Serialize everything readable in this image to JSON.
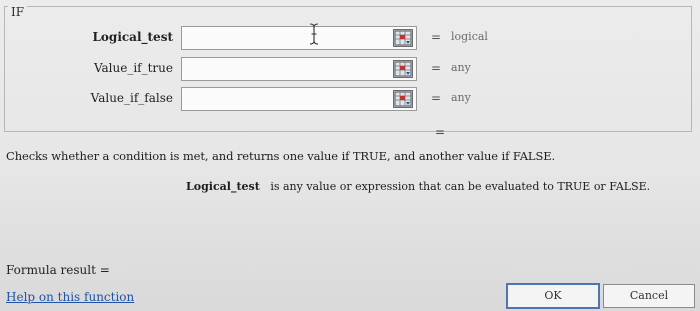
{
  "dialog": {
    "function_name": "IF",
    "arguments": [
      {
        "label": "Logical_test",
        "value": "",
        "result": "logical",
        "active": true
      },
      {
        "label": "Value_if_true",
        "value": "",
        "result": "any",
        "active": false
      },
      {
        "label": "Value_if_false",
        "value": "",
        "result": "any",
        "active": false
      }
    ],
    "equals": "=",
    "result_equals": "=",
    "description": "Checks whether a condition is met, and returns one value if TRUE, and another value if FALSE.",
    "argument_help": {
      "name": "Logical_test",
      "text": "is any value or expression that can be evaluated to TRUE or FALSE."
    },
    "formula_result_label": "Formula result =",
    "help_link": "Help on this function",
    "buttons": {
      "ok": "OK",
      "cancel": "Cancel"
    },
    "icons": {
      "range_selector": "range-selector-icon",
      "cursor": "text-cursor-icon"
    }
  }
}
